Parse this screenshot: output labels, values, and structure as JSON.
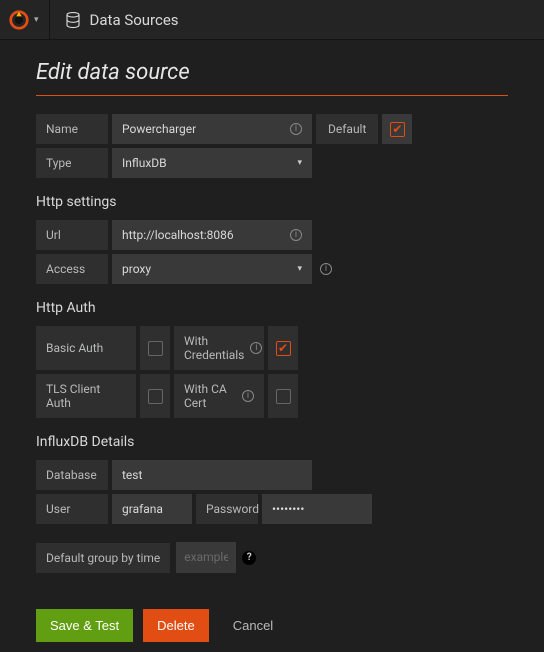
{
  "topbar": {
    "breadcrumb": "Data Sources"
  },
  "page": {
    "title": "Edit data source"
  },
  "basic": {
    "name_label": "Name",
    "name_value": "Powercharger",
    "default_label": "Default",
    "default_checked": true,
    "type_label": "Type",
    "type_value": "InfluxDB"
  },
  "http": {
    "section_title": "Http settings",
    "url_label": "Url",
    "url_value": "http://localhost:8086",
    "access_label": "Access",
    "access_value": "proxy"
  },
  "auth": {
    "section_title": "Http Auth",
    "basic_label": "Basic Auth",
    "basic_checked": false,
    "withcred_label": "With Credentials",
    "withcred_checked": true,
    "tls_label": "TLS Client Auth",
    "tls_checked": false,
    "cacert_label": "With CA Cert",
    "cacert_checked": false
  },
  "influx": {
    "section_title": "InfluxDB Details",
    "db_label": "Database",
    "db_value": "test",
    "user_label": "User",
    "user_value": "grafana",
    "password_label": "Password",
    "password_value": "••••••••",
    "groupby_label": "Default group by time",
    "groupby_placeholder": "example"
  },
  "buttons": {
    "save": "Save & Test",
    "delete": "Delete",
    "cancel": "Cancel"
  }
}
